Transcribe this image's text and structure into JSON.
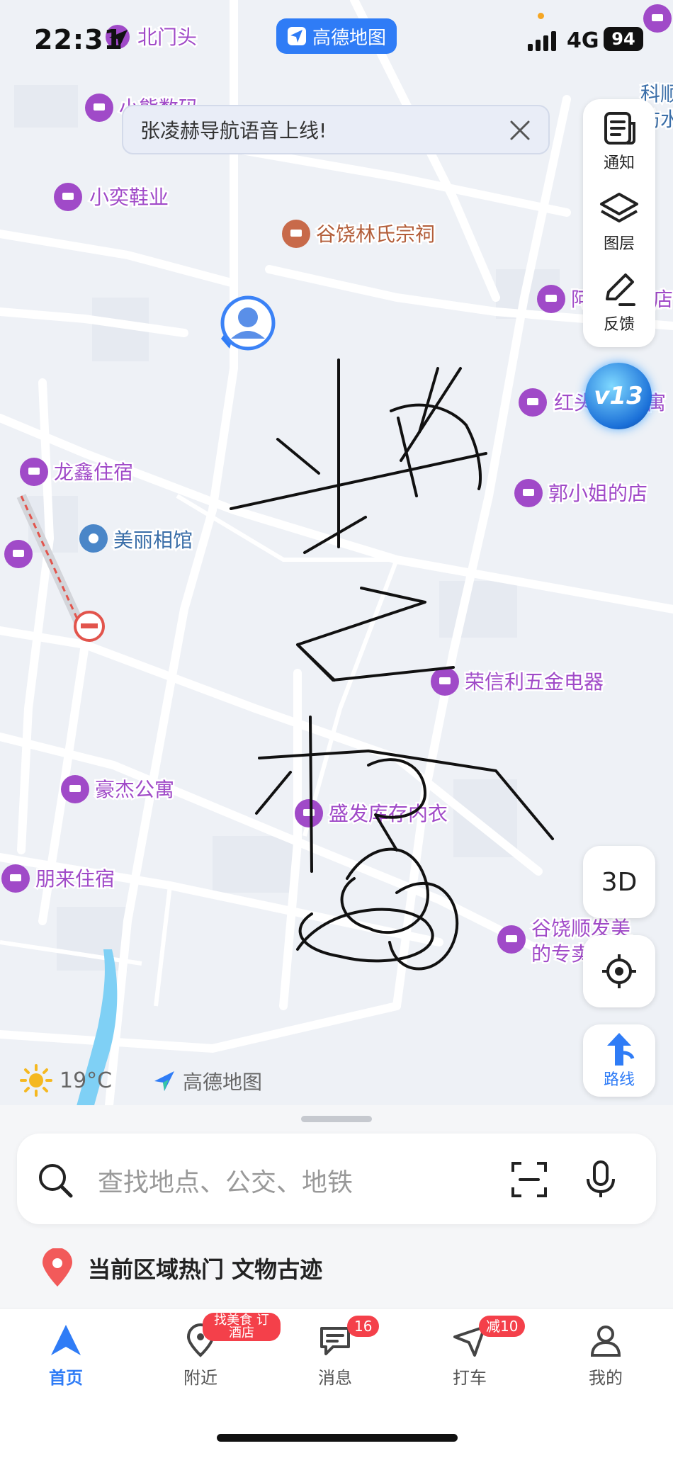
{
  "status_bar": {
    "time": "22:31",
    "app_name": "高德地图",
    "network": "4G",
    "battery": "94"
  },
  "banner": {
    "text": "张凌赫导航语音上线!"
  },
  "side_panel": {
    "notify_label": "通知",
    "layers_label": "图层",
    "feedback_label": "反馈"
  },
  "level_badge": "v13",
  "map_controls": {
    "three_d_label": "3D",
    "route_label": "路线"
  },
  "map": {
    "pois": [
      {
        "name": "北门头"
      },
      {
        "name": "小熊数码"
      },
      {
        "name": "小奕鞋业"
      },
      {
        "name": "谷饶林氏宗祠"
      },
      {
        "name": "阿"
      },
      {
        "name": "店"
      },
      {
        "name": "红头"
      },
      {
        "name": "寓"
      },
      {
        "name": "郭小姐的店"
      },
      {
        "name": "龙鑫住宿"
      },
      {
        "name": "美丽相馆"
      },
      {
        "name": "荣信利五金电器"
      },
      {
        "name": "豪杰公寓"
      },
      {
        "name": "盛发库存内衣"
      },
      {
        "name": "朋来住宿"
      },
      {
        "name": "谷饶顺发美"
      },
      {
        "name": "的专卖"
      },
      {
        "name": "科顺"
      },
      {
        "name": "防水"
      }
    ],
    "weather_temp": "19°C",
    "brand": "高德地图"
  },
  "search": {
    "placeholder": "查找地点、公交、地铁"
  },
  "hot_area": {
    "text": "当前区域热门 文物古迹"
  },
  "tabs": [
    {
      "label": "首页",
      "active": true
    },
    {
      "label": "附近",
      "badge": "找美食 订酒店"
    },
    {
      "label": "消息",
      "badge": "16"
    },
    {
      "label": "打车",
      "badge": "减10"
    },
    {
      "label": "我的"
    }
  ],
  "colors": {
    "accent": "#2f7cf6",
    "poi_purple": "#a04ac8",
    "badge_red": "#f4404a"
  }
}
